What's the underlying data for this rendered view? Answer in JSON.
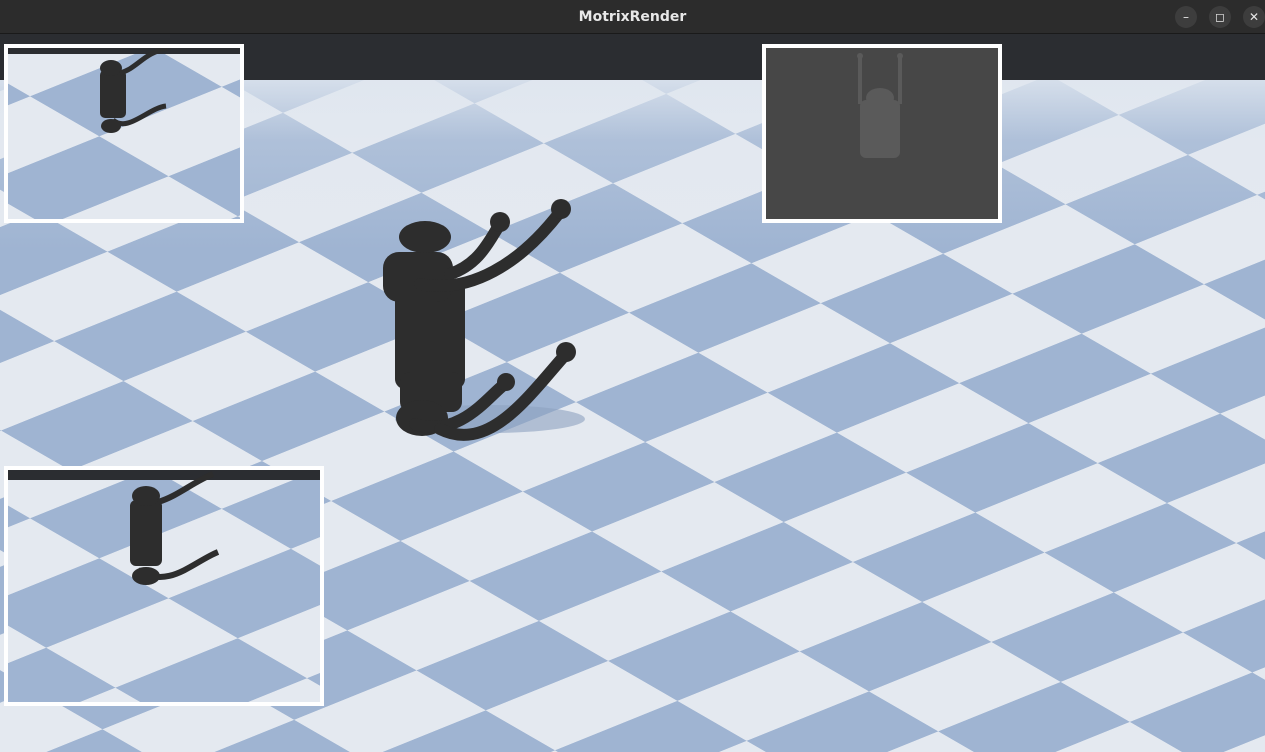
{
  "window": {
    "title": "MotrixRender",
    "controls": [
      {
        "name": "minimize",
        "glyph": "–"
      },
      {
        "name": "maximize",
        "glyph": "◻"
      },
      {
        "name": "close",
        "glyph": "✕"
      }
    ]
  },
  "scene": {
    "sky_color": "#2b2d31",
    "floor_light": "#e4e9f0",
    "floor_dark": "#9fb4d2",
    "robot_color": "#2d2d2d"
  },
  "insets": [
    {
      "name": "rgb-camera-top-left",
      "kind": "rgb"
    },
    {
      "name": "depth-camera-top-right",
      "kind": "depth"
    },
    {
      "name": "rgb-camera-bottom-left",
      "kind": "rgb"
    }
  ]
}
